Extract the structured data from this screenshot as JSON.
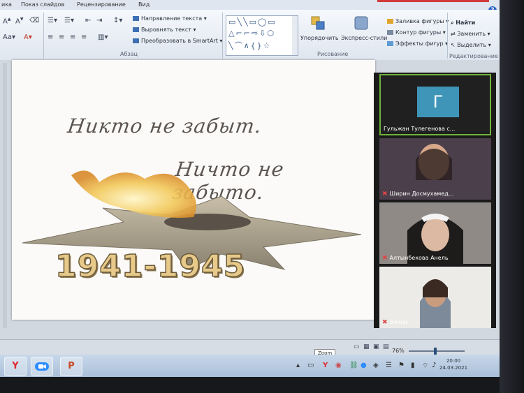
{
  "ribbon": {
    "tabs": [
      "ика",
      "Показ слайдов",
      "Рецензирование",
      "Вид"
    ],
    "paragraph": {
      "text_direction": "Направление текста",
      "align_text": "Выровнять текст",
      "convert_smartart": "Преобразовать в SmartArt",
      "group_label": "Абзац"
    },
    "drawing": {
      "arrange": "Упорядочить",
      "express_styles": "Экспресс-стили",
      "shape_fill": "Заливка фигуры",
      "shape_outline": "Контур фигуры",
      "shape_effects": "Эффекты фигур",
      "group_label": "Рисование"
    },
    "editing": {
      "find": "Найти",
      "replace": "Заменить",
      "select": "Выделить",
      "group_label": "Редактирование"
    }
  },
  "slide": {
    "line1": "Никто не забыт.",
    "line2": "Ничто не забыто.",
    "years": "1941-1945"
  },
  "participants": [
    {
      "avatar_letter": "Г",
      "name": "Гульжан Тулегенова с...",
      "active": true
    },
    {
      "name": "Ширин Досмухамед..."
    },
    {
      "name": "Алтынбекова Анель"
    },
    {
      "name": "Элина"
    }
  ],
  "statusbar": {
    "zoom_tooltip": "Zoom",
    "zoom_value": "76%"
  },
  "taskbar": {
    "clock_time": "20:00",
    "clock_date": "24.03.2021"
  },
  "colors": {
    "zoom_avatar": "#3f95b7",
    "active_speaker_border": "#6fb33a",
    "muted_mic": "#e04545"
  }
}
